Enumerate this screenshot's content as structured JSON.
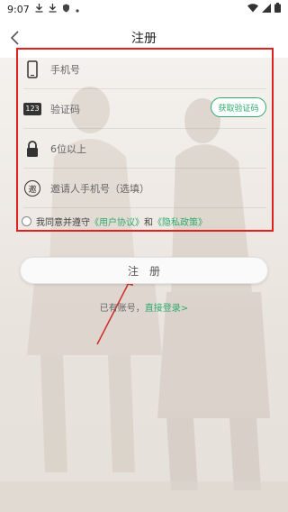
{
  "status_bar": {
    "time": "9:07",
    "icons": [
      "download-icon",
      "download-icon",
      "shield-icon",
      "dot-icon",
      "wifi-icon",
      "signal-icon",
      "battery-icon"
    ]
  },
  "header": {
    "title": "注册",
    "back_icon": "chevron-left-icon"
  },
  "form": {
    "phone": {
      "icon": "phone-icon",
      "placeholder": "手机号"
    },
    "code": {
      "icon": "number-123-icon",
      "icon_text": "123",
      "placeholder": "验证码",
      "button_label": "获取验证码"
    },
    "password": {
      "icon": "lock-icon",
      "placeholder": "6位以上"
    },
    "inviter": {
      "icon": "invite-icon",
      "icon_text": "邀",
      "placeholder": "邀请人手机号（选填）"
    },
    "agreement": {
      "prefix": "我同意并遵守",
      "user_agreement": "《用户协议》",
      "conjunction": "和",
      "privacy_policy": "《隐私政策》"
    }
  },
  "actions": {
    "register_label": "注册",
    "has_account": "已有账号，",
    "login_link": "直接登录>"
  },
  "colors": {
    "accent": "#2fab6e",
    "highlight_box": "#e0211f",
    "arrow": "#d42a24"
  }
}
